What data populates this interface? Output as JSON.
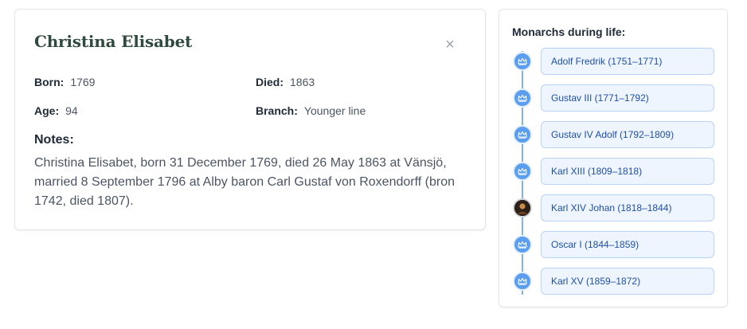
{
  "person": {
    "name": "Christina Elisabet",
    "close_symbol": "×",
    "born_label": "Born:",
    "born_value": "1769",
    "died_label": "Died:",
    "died_value": "1863",
    "age_label": "Age:",
    "age_value": "94",
    "branch_label": "Branch:",
    "branch_value": "Younger line",
    "notes_label": "Notes:",
    "notes_text": "Christina Elisabet, born 31 December 1769, died 26 May 1863 at Vänsjö, married 8 September 1796 at Alby baron Carl Gustaf von Roxendorff (bron 1742, died 1807)."
  },
  "monarchs": {
    "title": "Monarchs during life:",
    "items": [
      {
        "label": "Adolf Fredrik (1751–1771)",
        "icon": "crown-icon"
      },
      {
        "label": "Gustav III (1771–1792)",
        "icon": "crown-icon"
      },
      {
        "label": "Gustav IV Adolf (1792–1809)",
        "icon": "crown-icon"
      },
      {
        "label": "Karl XIII (1809–1818)",
        "icon": "crown-icon"
      },
      {
        "label": "Karl XIV Johan (1818–1844)",
        "icon": "portrait-avatar"
      },
      {
        "label": "Oscar I (1844–1859)",
        "icon": "crown-icon"
      },
      {
        "label": "Karl XV (1859–1872)",
        "icon": "crown-icon"
      }
    ]
  },
  "colors": {
    "accent": "#5b9ef0",
    "pill_bg": "#eef5ff",
    "pill_text": "#1e4fa8",
    "name_color": "#2f4a3e"
  }
}
